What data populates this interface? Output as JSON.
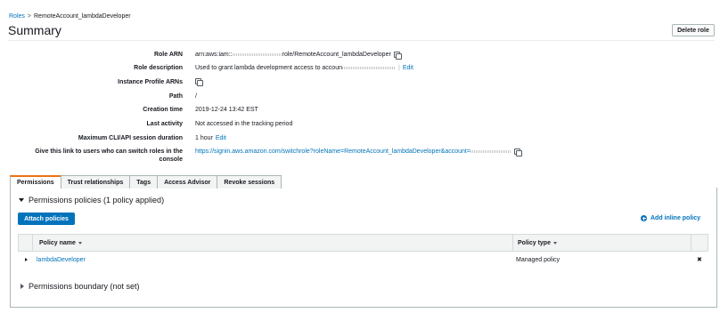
{
  "breadcrumb": {
    "root": "Roles",
    "separator": ">",
    "current": "RemoteAccount_lambdaDeveloper"
  },
  "page": {
    "title": "Summary",
    "delete_label": "Delete role"
  },
  "summary": {
    "role_arn": {
      "label": "Role ARN",
      "prefix": "arn:aws:iam::",
      "suffix": "role/RemoteAccount_lambdaDeveloper"
    },
    "role_description": {
      "label": "Role description",
      "text": "Used to grant lambda development access to accoun",
      "edit": "Edit"
    },
    "instance_profile": {
      "label": "Instance Profile ARNs"
    },
    "path": {
      "label": "Path",
      "value": "/"
    },
    "creation_time": {
      "label": "Creation time",
      "value": "2019-12-24 13:42 EST"
    },
    "last_activity": {
      "label": "Last activity",
      "value": "Not accessed in the tracking period"
    },
    "max_session": {
      "label": "Maximum CLI/API session duration",
      "value": "1 hour",
      "edit": "Edit"
    },
    "switch_link": {
      "label_line1": "Give this link to users who can switch roles in the",
      "label_line2": "console",
      "url": "https://signin.aws.amazon.com/switchrole?roleName=RemoteAccount_lambdaDeveloper&account="
    }
  },
  "tabs": [
    "Permissions",
    "Trust relationships",
    "Tags",
    "Access Advisor",
    "Revoke sessions"
  ],
  "permissions": {
    "policies_title": "Permissions policies (1 policy applied)",
    "attach_label": "Attach policies",
    "add_inline_label": "Add inline policy",
    "columns": {
      "name": "Policy name",
      "type": "Policy type"
    },
    "rows": [
      {
        "name": "lambdaDeveloper",
        "type": "Managed policy"
      }
    ],
    "boundary_title": "Permissions boundary (not set)"
  }
}
